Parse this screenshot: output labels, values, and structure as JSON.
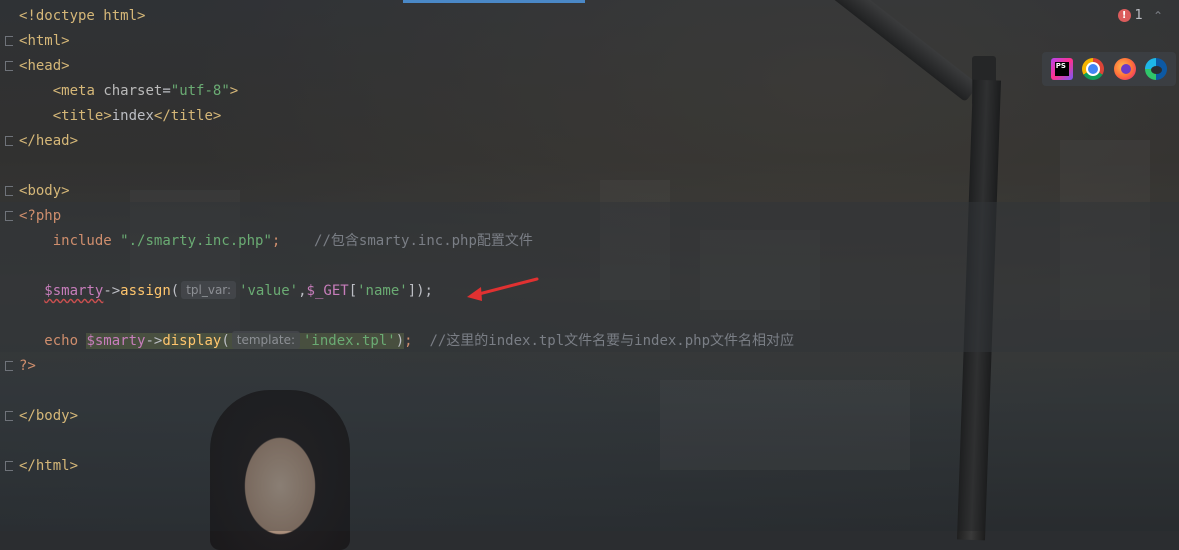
{
  "editor": {
    "lines": [
      {
        "t": "<!doctype html>"
      },
      {
        "t": "<html>"
      },
      {
        "t": "<head>"
      },
      {
        "t": "<meta charset=\"utf-8\">"
      },
      {
        "t": "<title>index</title>"
      },
      {
        "t": "</head>"
      },
      {
        "t": ""
      },
      {
        "t": "<body>"
      },
      {
        "t": "<?php"
      },
      {
        "t": "include \"./smarty.inc.php\";    //包含smarty.inc.php配置文件"
      },
      {
        "t": ""
      },
      {
        "t": "$smarty->assign( tpl_var: 'value',$_GET['name']);"
      },
      {
        "t": ""
      },
      {
        "t": "echo $smarty->display( template: 'index.tpl');  //这里的index.tpl文件名要与index.php文件名相对应"
      },
      {
        "t": "?>"
      },
      {
        "t": ""
      },
      {
        "t": "</body>"
      },
      {
        "t": ""
      },
      {
        "t": "</html>"
      }
    ],
    "tokens": {
      "doctype": "<!doctype html>",
      "html_open": "html",
      "head_open": "head",
      "meta_tag": "meta",
      "meta_attr": "charset",
      "meta_val": "\"utf-8\"",
      "title_tag": "title",
      "title_text": "index",
      "head_close": "head",
      "body_open": "body",
      "php_open": "<?php",
      "include_kw": "include",
      "include_path": "\"./smarty.inc.php\"",
      "include_comment": "//包含smarty.inc.php配置文件",
      "smarty_var": "$smarty",
      "assign_fn": "assign",
      "hint_tpl_var": "tpl_var:",
      "value_str": "'value'",
      "get_var": "$_GET",
      "name_str": "'name'",
      "echo_kw": "echo",
      "display_fn": "display",
      "hint_template": "template:",
      "index_tpl_str": "'index.tpl'",
      "display_comment": "//这里的index.tpl文件名要与index.php文件名相对应",
      "php_close": "?>",
      "body_close": "body",
      "html_close": "html"
    }
  },
  "status": {
    "error_count": "1",
    "error_icon": "error-icon"
  },
  "browser_popup": {
    "icons": [
      "phpstorm-icon",
      "chrome-icon",
      "firefox-icon",
      "edge-icon"
    ],
    "phpstorm_label": "PS"
  },
  "colors": {
    "tag": "#d5b778",
    "string": "#6aab73",
    "keyword": "#cf8e6d",
    "variable": "#c77dbb",
    "function": "#ffc66d",
    "comment": "#7a7e85",
    "arrow": "#e03131"
  }
}
